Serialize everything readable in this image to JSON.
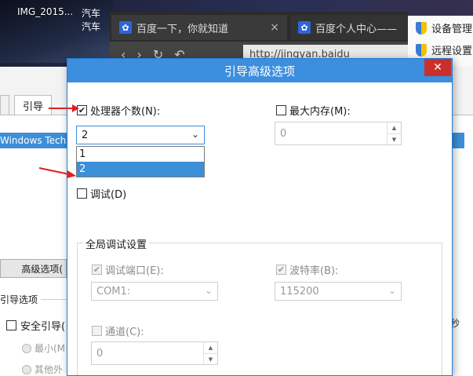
{
  "desktop": {
    "thumb_label": "IMG_2015...",
    "thumb_label2": "汽车",
    "thumb_label3": "汽车"
  },
  "browser": {
    "tabs": [
      {
        "label": "百度一下，你就知道",
        "icon": "paw-icon"
      },
      {
        "label": "百度个人中心——",
        "icon": "paw-icon"
      }
    ],
    "url": "http://jingyan.baidu"
  },
  "right_panel": {
    "items": [
      {
        "label": "设备管理",
        "icon": "shield-icon"
      },
      {
        "label": "远程设置",
        "icon": "shield-icon"
      }
    ]
  },
  "bg_window": {
    "boot_tab": "引导",
    "os_row": "Windows Tech",
    "advanced_button": "高级选项(",
    "boot_options_group": "引导选项",
    "safe_boot": "安全引导(",
    "radio_minimal": "最小(M",
    "radio_other": "其他外",
    "right_text": "秒"
  },
  "dialog": {
    "title": "引导高级选项",
    "close": "✕",
    "num_processors": {
      "label": "处理器个数(N):",
      "checked": true,
      "value": "2",
      "options": [
        "1",
        "2"
      ],
      "selected": "2"
    },
    "max_memory": {
      "label": "最大内存(M):",
      "checked": false,
      "value": "0"
    },
    "debug": {
      "label": "调试(D)",
      "checked": false
    },
    "global_debug": {
      "title": "全局调试设置",
      "debug_port": {
        "label": "调试端口(E):",
        "checked": true,
        "value": "COM1:"
      },
      "baud_rate": {
        "label": "波特率(B):",
        "checked": true,
        "value": "115200"
      },
      "channel": {
        "label": "通道(C):",
        "checked": false,
        "value": "0"
      }
    }
  },
  "colors": {
    "titlebar": "#3c8ede",
    "close": "#c9302c",
    "selection": "#3d8fd8",
    "arrow": "#e02020"
  }
}
